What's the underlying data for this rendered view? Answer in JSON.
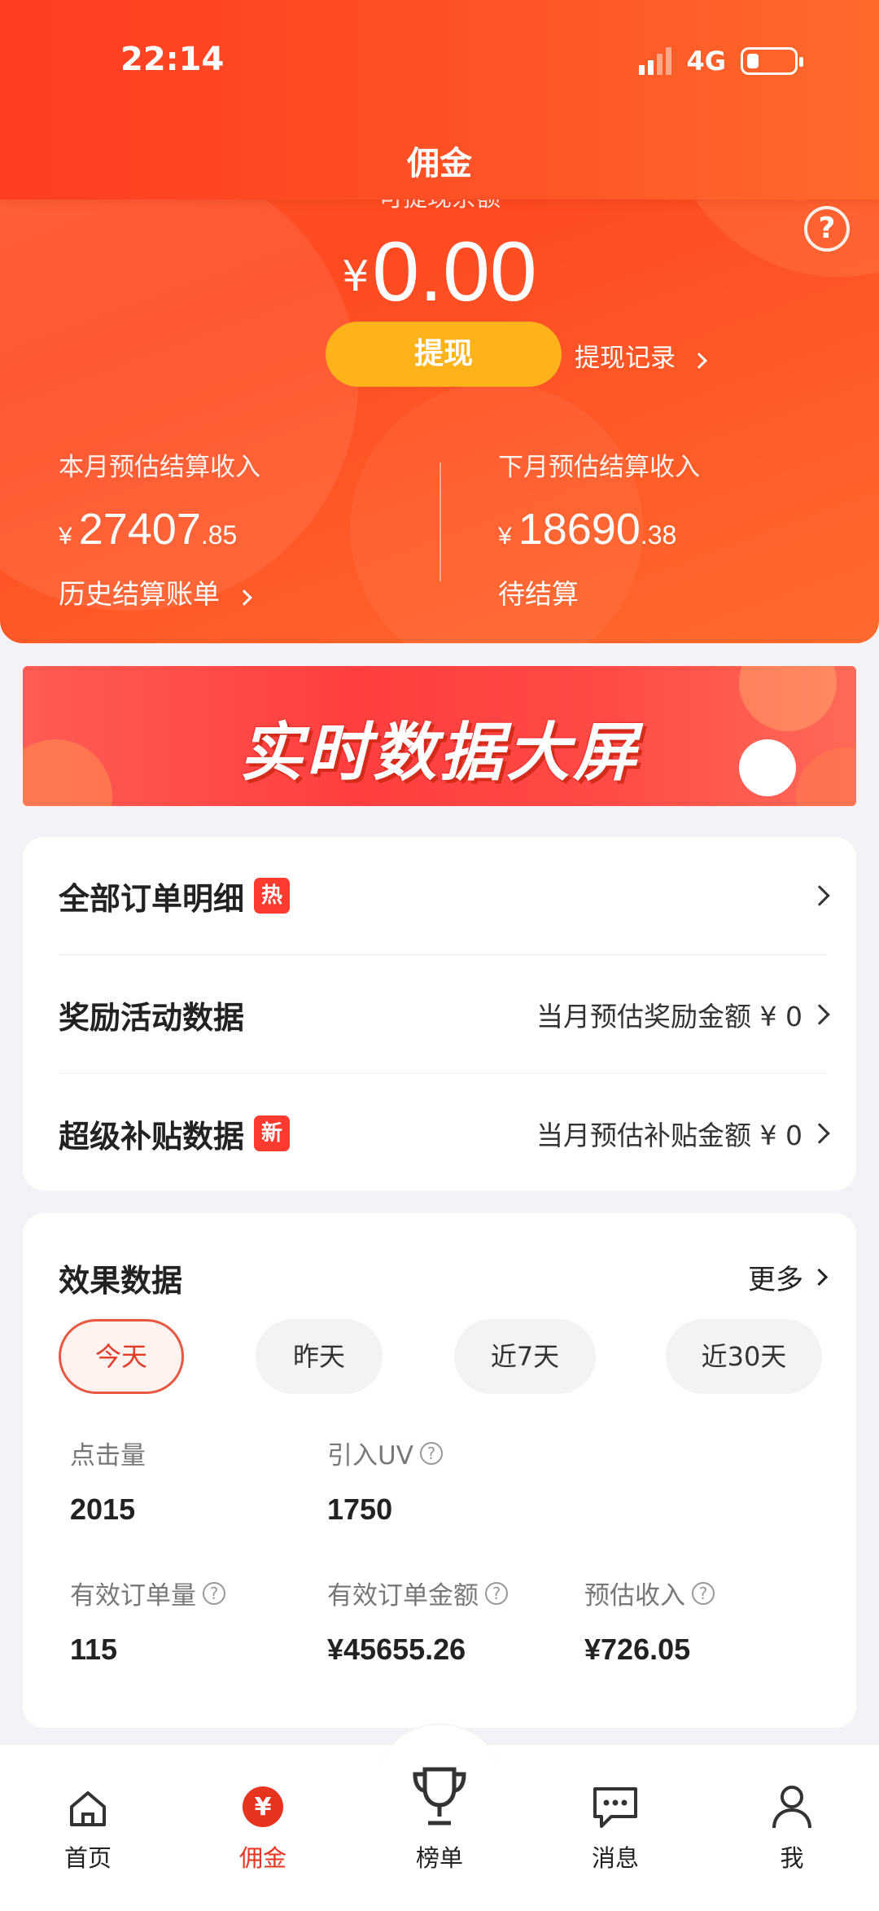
{
  "status_bar": {
    "time": "22:14",
    "network": "4G"
  },
  "header": {
    "title": "佣金",
    "withdrawable_label": "可提现余额",
    "currency": "¥",
    "balance": "0.00",
    "withdraw_button": "提现",
    "withdraw_record": "提现记录",
    "help": "?"
  },
  "settlement": {
    "this_month": {
      "label": "本月预估结算收入",
      "currency": "¥",
      "int": "27407",
      "dec": ".85",
      "link": "历史结算账单"
    },
    "next_month": {
      "label": "下月预估结算收入",
      "currency": "¥",
      "int": "18690",
      "dec": ".38",
      "status": "待结算"
    }
  },
  "banner": {
    "text": "实时数据大屏"
  },
  "menu": [
    {
      "label": "全部订单明细",
      "tag": "热",
      "right": ""
    },
    {
      "label": "奖励活动数据",
      "tag": "",
      "right": "当月预估奖励金额 ¥ 0"
    },
    {
      "label": "超级补贴数据",
      "tag": "新",
      "right": "当月预估补贴金额 ¥ 0"
    }
  ],
  "effect": {
    "title": "效果数据",
    "more": "更多",
    "ranges": [
      "今天",
      "昨天",
      "近7天",
      "近30天"
    ],
    "active_range": "今天",
    "metrics": [
      {
        "label": "点击量",
        "value": "2015"
      },
      {
        "label": "引入UV",
        "value": "1750"
      },
      {
        "label": "有效订单量",
        "value": "115"
      },
      {
        "label": "有效订单金额",
        "value": "¥45655.26"
      },
      {
        "label": "预估收入",
        "value": "¥726.05"
      }
    ]
  },
  "tabbar": [
    {
      "label": "首页",
      "icon": "home-icon"
    },
    {
      "label": "佣金",
      "icon": "yuan-icon",
      "active": true
    },
    {
      "label": "榜单",
      "icon": "trophy-icon"
    },
    {
      "label": "消息",
      "icon": "message-icon"
    },
    {
      "label": "我",
      "icon": "person-icon"
    }
  ],
  "colors": {
    "brand": "#ff4a22",
    "button": "#ffb21a",
    "active_tab": "#e8331f",
    "tag": "#ff3b2f"
  }
}
